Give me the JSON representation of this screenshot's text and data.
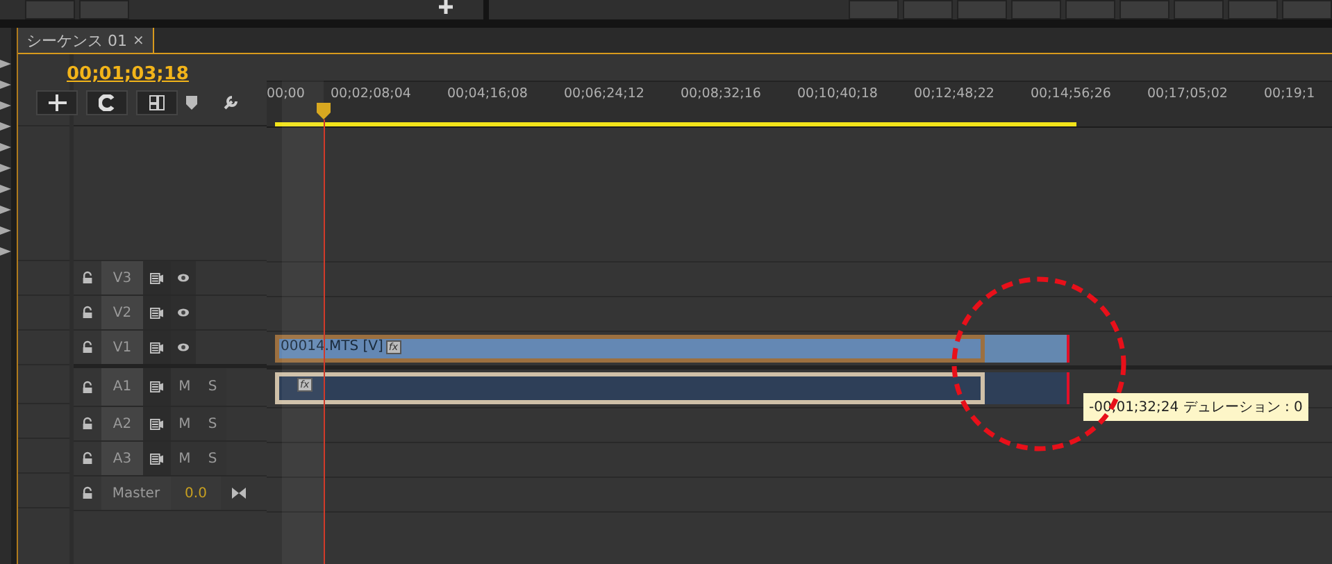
{
  "tab": {
    "label": "シーケンス 01",
    "close": "×",
    "selected": true
  },
  "timecode": "00;01;03;18",
  "ruler": [
    "00;00",
    "00;02;08;04",
    "00;04;16;08",
    "00;06;24;12",
    "00;08;32;16",
    "00;10;40;18",
    "00;12;48;22",
    "00;14;56;26",
    "00;17;05;02",
    "00;19;1"
  ],
  "tracks": [
    {
      "kind": "video",
      "name": "V3"
    },
    {
      "kind": "video",
      "name": "V2"
    },
    {
      "kind": "video",
      "name": "V1",
      "clip": {
        "label": "00014.MTS [V]",
        "fx": "fx"
      }
    },
    {
      "kind": "audio",
      "name": "A1",
      "mute": "M",
      "solo": "S",
      "clip": {
        "fx": "fx"
      }
    },
    {
      "kind": "audio",
      "name": "A2",
      "mute": "M",
      "solo": "S"
    },
    {
      "kind": "audio",
      "name": "A3",
      "mute": "M",
      "solo": "S"
    },
    {
      "kind": "master",
      "name": "Master",
      "volume": "0.0"
    }
  ],
  "tooltip": "-00;01;32;24 デュレーション : 0"
}
